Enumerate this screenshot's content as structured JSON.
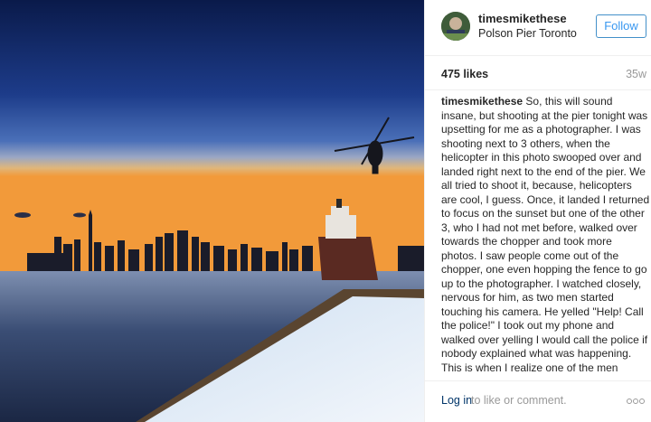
{
  "post": {
    "photo_alt": "helicopter-over-pier-icon",
    "header": {
      "username": "timesmikethese",
      "location": "Polson Pier Toronto",
      "follow_label": "Follow"
    },
    "likes": "475 likes",
    "age": "35w",
    "caption": {
      "username": "timesmikethese",
      "text": "So, this will sound insane, but shooting at the pier tonight was upsetting for me as a photographer. I was shooting next to 3 others, when the helicopter in this photo swooped over and landed right next to the end of the pier. We all tried to shoot it, because, helicopters are cool, I guess. Once, it landed I returned to focus on the sunset but one of the other 3, who I had not met before, walked over towards the chopper and took more photos. I saw people come out of the chopper, one even hopping the fence to go up to the photographer. I watched closely, nervous for him, as two men started touching his camera. He yelled \"Help! Call the police!\" I took out my phone and walked over yelling I would call the police if nobody explained what was happening. This is when I realize one of the men around the photographer was Drake ("
    },
    "footer": {
      "login_label": "Log in",
      "login_suffix": "to like or comment.",
      "more_icon": "more-options-icon"
    }
  },
  "colors": {
    "link_blue": "#3897f0",
    "follow_border": "#4390c9",
    "muted": "#999999",
    "text": "#262626"
  }
}
